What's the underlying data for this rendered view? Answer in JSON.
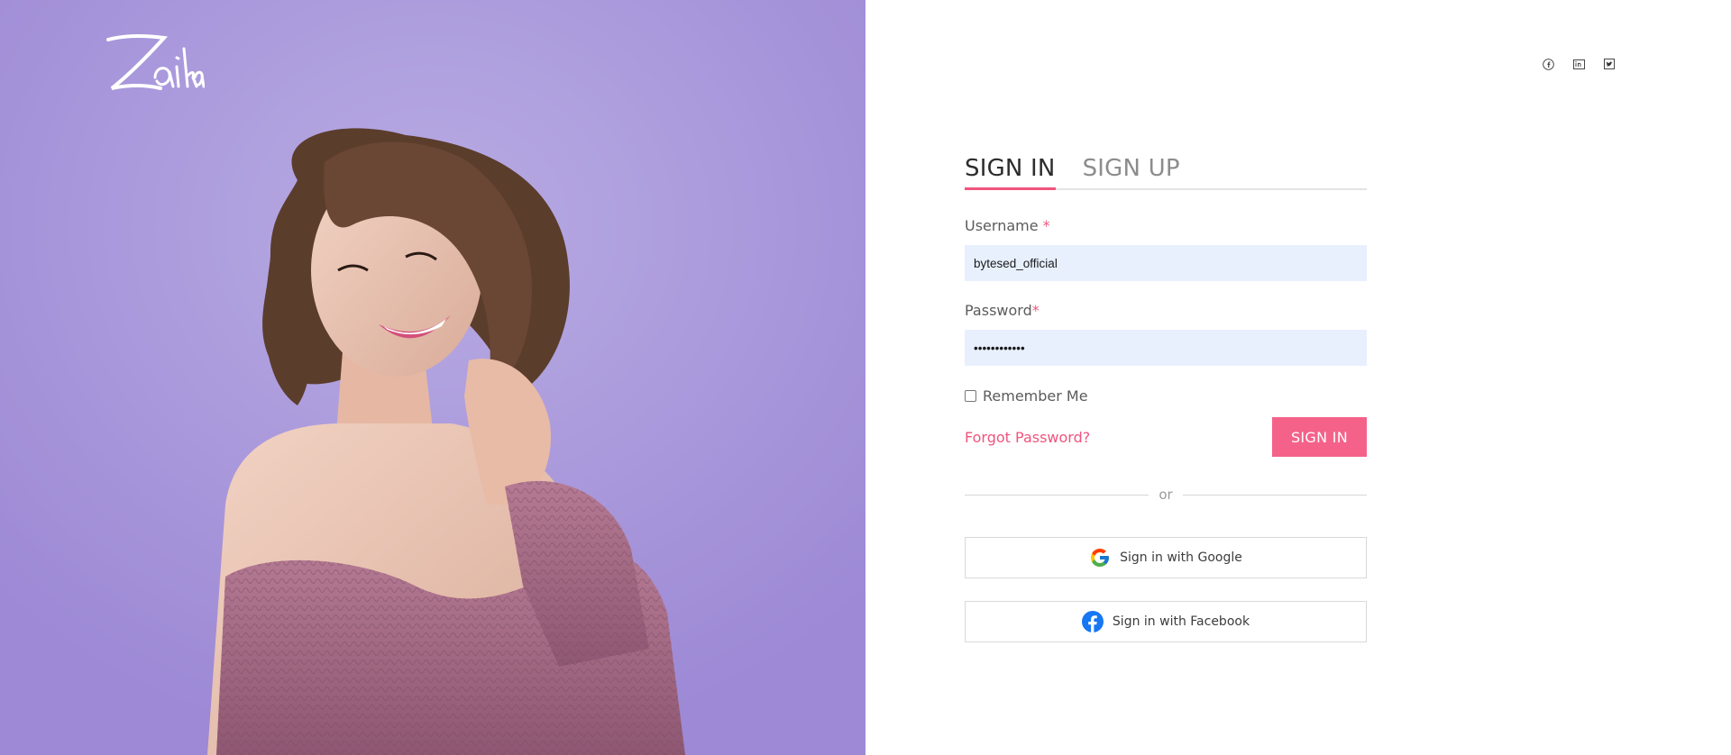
{
  "brand": {
    "logo_text": "Zaika"
  },
  "header": {
    "social": [
      {
        "icon": "facebook-icon"
      },
      {
        "icon": "linkedin-icon"
      },
      {
        "icon": "twitter-icon"
      }
    ]
  },
  "tabs": [
    {
      "label": "SIGN IN",
      "active": true
    },
    {
      "label": "SIGN UP",
      "active": false
    }
  ],
  "form": {
    "username": {
      "label": "Username",
      "required_mark": "*",
      "value": "bytesed_official"
    },
    "password": {
      "label": "Password",
      "required_mark": "*",
      "value": "••••••••••••"
    },
    "remember_label": "Remember Me",
    "forgot_label": "Forgot Password?",
    "submit_label": "SIGN IN",
    "divider_text": "or",
    "google_label": "Sign in with Google",
    "facebook_label": "Sign in with Facebook"
  },
  "colors": {
    "accent": "#f0547e",
    "button": "#f4628a",
    "hero_bg": "#a795dc",
    "input_bg": "#e8f0fe"
  }
}
